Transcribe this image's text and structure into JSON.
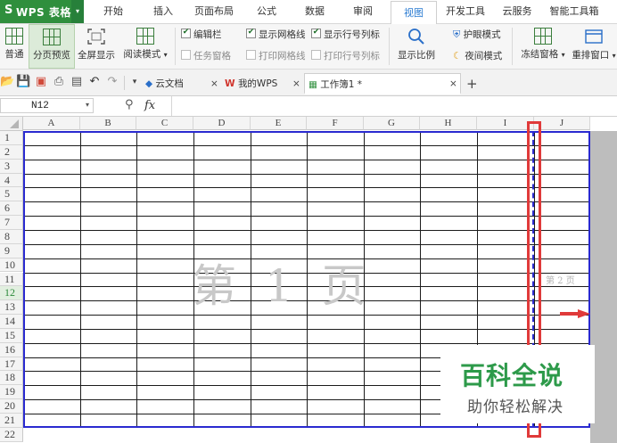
{
  "app": {
    "logo_glyph": "S",
    "logo_text": "WPS 表格",
    "dropdown_glyph": "▾"
  },
  "menu": {
    "tabs": [
      "开始",
      "插入",
      "页面布局",
      "公式",
      "数据",
      "审阅",
      "视图",
      "开发工具",
      "云服务",
      "智能工具箱"
    ],
    "active_tab": "视图"
  },
  "ribbon": {
    "normal": "普通",
    "page_break_preview": "分页预览",
    "fullscreen": "全屏显示",
    "reading_mode": "阅读模式",
    "reading_mode_arrow": "▾",
    "edit_bar": {
      "label": "编辑栏",
      "checked": true
    },
    "task_pane": {
      "label": "任务窗格",
      "checked": false
    },
    "show_gridlines": {
      "label": "显示网格线",
      "checked": true
    },
    "print_gridlines": {
      "label": "打印网格线",
      "checked": false
    },
    "show_headings": {
      "label": "显示行号列标",
      "checked": true
    },
    "print_headings": {
      "label": "打印行号列标",
      "checked": false
    },
    "zoom": "显示比例",
    "eye_mode": "护眼模式",
    "night_mode": "夜间模式",
    "freeze_panes": "冻结窗格",
    "freeze_arrow": "▾",
    "rearrange_windows": "重排窗口",
    "rearrange_arrow": "▾"
  },
  "quick_access": {
    "more_glyph": "▾",
    "doc_tabs": [
      {
        "label": "云文档",
        "close": "×"
      },
      {
        "label": "我的WPS",
        "close": "×"
      },
      {
        "label": "工作簿1 *",
        "close": "×"
      }
    ],
    "new_tab": "+"
  },
  "formula_bar": {
    "cell_ref": "N12",
    "cell_ref_arrow": "▾",
    "fx": "fx",
    "formula": ""
  },
  "sheet": {
    "columns": [
      "A",
      "B",
      "C",
      "D",
      "E",
      "F",
      "G",
      "H",
      "I",
      "J"
    ],
    "rows": [
      "1",
      "2",
      "3",
      "4",
      "5",
      "6",
      "7",
      "8",
      "9",
      "10",
      "11",
      "12",
      "13",
      "14",
      "15",
      "16",
      "17",
      "18",
      "19",
      "20",
      "21",
      "22"
    ],
    "selected_row": "12",
    "page1_label": "第 1 页",
    "page2_label": "第 2 页"
  },
  "brand": {
    "title": "百科全说",
    "subtitle": "助你轻松解决",
    "color": "#2d9a4a"
  },
  "colors": {
    "accent": "#2f8f3d",
    "page_border": "#2a2ad0",
    "annotation": "#e03a3a"
  }
}
